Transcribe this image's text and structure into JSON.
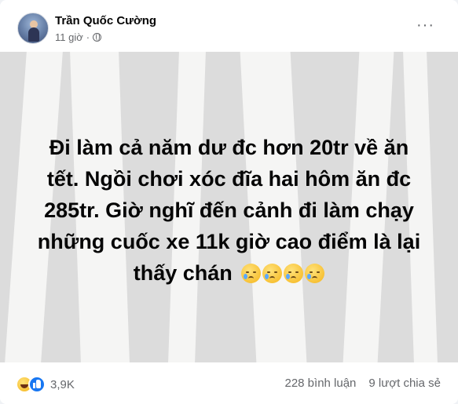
{
  "post": {
    "author": "Trần Quốc Cường",
    "time": "11 giờ",
    "separator": "·",
    "more_label": "···",
    "lines": [
      "Đi làm cả năm dư đc hơn 20tr về ăn",
      "tết. Ngồi chơi xóc đĩa hai hôm ăn đc",
      "285tr. Giờ nghĩ đến cảnh đi làm chạy",
      "những cuốc xe 11k giờ cao điểm là lại",
      "thấy chán"
    ],
    "emojis": [
      "crying-face-icon",
      "crying-face-icon",
      "crying-face-icon",
      "crying-face-icon"
    ]
  },
  "footer": {
    "reaction_count": "3,9K",
    "comments": "228 bình luận",
    "shares": "9 lượt chia sẻ",
    "reactions": [
      "haha-icon",
      "like-icon"
    ]
  },
  "colors": {
    "background_image": "#dcdcdc",
    "tree": "#f5f5f4",
    "like": "#1877f2",
    "secondary_text": "#65676b"
  }
}
